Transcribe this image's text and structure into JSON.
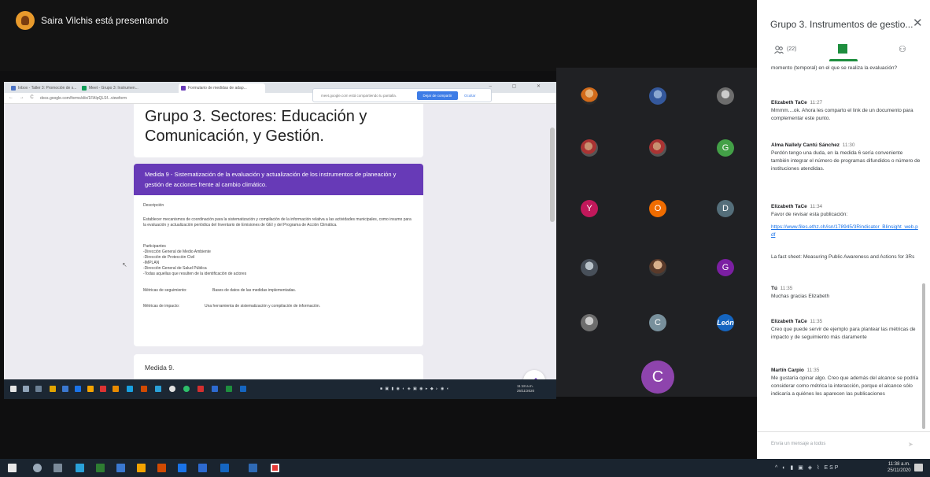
{
  "presenting": {
    "text": "Saira Vilchis está presentando"
  },
  "browser": {
    "tabs": [
      "Inbox - Taller 3: Promoción de s...",
      "Meet - Grupo 3: Instrumen...",
      "Formulario de medidas de adap..."
    ],
    "url": "docs.google.com/forms/d/e/1FAIpQLSf...viewform",
    "share_banner": "meet.google.com está compartiendo tu pantalla.",
    "stop_label": "Dejar de compartir",
    "hide_label": "Ocultar"
  },
  "form": {
    "title": "Grupo 3. Sectores: Educación y Comunicación, y Gestión.",
    "section_header": "Medida 9 - Sistematización de la evaluación y actualización de los instrumentos de planeación y gestión de acciones frente al cambio climático.",
    "desc_label": "Descripción",
    "desc_text": "Establecer mecanismos de coordinación para la sistematización y compilación de la información relativa a las actividades municipales, como insumo para la evaluación y actualización periódica del Inventario de Emisiones de GEI y del Programa de Acción Climática.",
    "participants_label": "Participantes",
    "participants": [
      "-Dirección General de Medio Ambiente",
      "-Dirección de Protección Civil",
      "-IMPLAN",
      "-Dirección General de Salud Pública",
      "-Todas aquellas que resulten de la identificación de actores"
    ],
    "metric_follow_label": "Métricas de seguimiento:",
    "metric_follow_value": "Bases de datos de las medidas implementadas.",
    "metric_impact_label": "Métricas de impacto:",
    "metric_impact_value": "Una herramienta de sistematización y compilación de información.",
    "next_card_title": "Medida 9."
  },
  "inner_taskbar": {
    "time": "11:18 a.m.",
    "date": "25/11/2020"
  },
  "participants": [
    {
      "kind": "photo6",
      "letter": ""
    },
    {
      "kind": "photo3",
      "letter": ""
    },
    {
      "kind": "photo4",
      "letter": ""
    },
    {
      "kind": "photo2",
      "letter": ""
    },
    {
      "kind": "photo2",
      "letter": ""
    },
    {
      "kind": "avatar",
      "letter": "G",
      "color": "#43a047"
    },
    {
      "kind": "avatar",
      "letter": "Y",
      "color": "#c2185b"
    },
    {
      "kind": "avatar",
      "letter": "O",
      "color": "#ef6c00"
    },
    {
      "kind": "avatar",
      "letter": "D",
      "color": "#546e7a"
    },
    {
      "kind": "photo5",
      "letter": ""
    },
    {
      "kind": "photo",
      "letter": ""
    },
    {
      "kind": "avatar",
      "letter": "G",
      "color": "#7b1fa2"
    },
    {
      "kind": "photo4",
      "letter": ""
    },
    {
      "kind": "avatar",
      "letter": "C",
      "color": "#78909c"
    },
    {
      "kind": "leon",
      "letter": "León",
      "color": "#1565c0"
    }
  ],
  "self_tile": {
    "letter": "C",
    "color": "#8e44ad"
  },
  "chat": {
    "title": "Grupo 3. Instrumentos de gestio...",
    "people_count": "(22)",
    "input_placeholder": "Envía un mensaje a todos",
    "messages": [
      {
        "author": "",
        "time": "",
        "text": "momento (temporal) en el que se realiza la evaluación?"
      },
      {
        "author": "Elizabeth TaCe",
        "time": "11:27",
        "text": "Mmmm....ok. Ahora les comparto el link de un documento para complementar este punto."
      },
      {
        "author": "Alma Nallely Cantú Sánchez",
        "time": "11:30",
        "text": "Perdón tengo una duda, en la medida 6 sería conveniente también integrar el número de programas difundidos o número de instituciones atendidas."
      },
      {
        "author": "Elizabeth TaCe",
        "time": "11:34",
        "text": "Favor de revisar esta publicación:",
        "link": "https://www.files.ethz.ch/isn/178945/3Rindicator_Blinsight_web.pdf"
      },
      {
        "author": "",
        "time": "",
        "text": "La fact sheet: Measuring Public Awareness and Actions for 3Rs"
      },
      {
        "author": "Tú",
        "time": "11:35",
        "text": "Muchas gracias Elizabeth"
      },
      {
        "author": "Elizabeth TaCe",
        "time": "11:35",
        "text": "Creo que puede servir de ejemplo para plantear las métricas de impacto y de seguimiento más claramente"
      },
      {
        "author": "Martín Carpio",
        "time": "11:35",
        "text": "Me gustaría opinar algo. Creo que además del alcance se podría considerar como métrica la interacción, porque el alcance sólo indicaría a quiénes les aparecen las publicaciones"
      }
    ]
  },
  "taskbar": {
    "lang": "ESP",
    "time": "11:38 a.m.",
    "date": "25/11/2020"
  }
}
